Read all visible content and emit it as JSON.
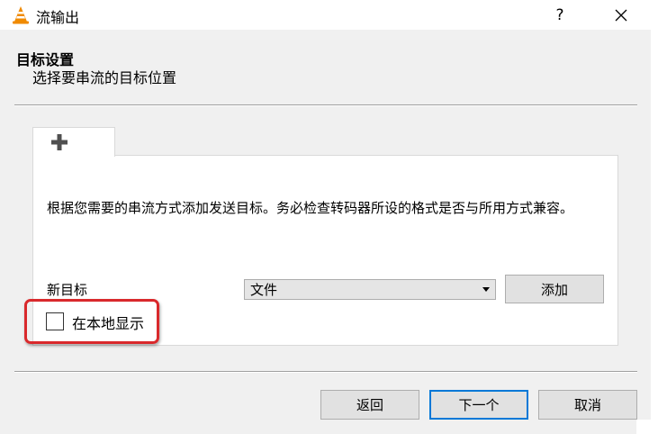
{
  "window": {
    "title": "流输出",
    "help_label": "?",
    "close_icon": "close-icon",
    "app_icon": "vlc-cone-icon"
  },
  "header": {
    "title": "目标设置",
    "subtitle": "选择要串流的目标位置"
  },
  "tab": {
    "icon": "plus-icon"
  },
  "panel": {
    "description": "根据您需要的串流方式添加发送目标。务必检查转码器所设的格式是否与所用方式兼容。",
    "new_target_label": "新目标",
    "target_select_value": "文件",
    "add_button": "添加",
    "display_locally_label": "在本地显示",
    "display_locally_checked": false
  },
  "footer": {
    "back_button": "返回",
    "next_button": "下一个",
    "cancel_button": "取消"
  },
  "colors": {
    "highlight": "#d9292c",
    "default_button_border": "#0078d7",
    "dialog_background": "#f0f0f0"
  }
}
